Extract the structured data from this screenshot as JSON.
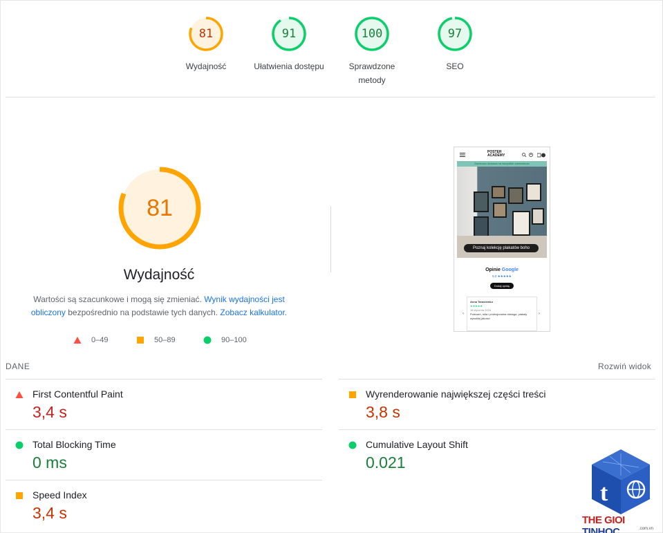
{
  "top_scores": [
    {
      "score": "81",
      "label": "Wydajność",
      "fraction": 0.81,
      "color": "#ffa400"
    },
    {
      "score": "91",
      "label": "Ułatwienia dostępu",
      "fraction": 0.91,
      "color": "#0cce6b"
    },
    {
      "score": "100",
      "label": "Sprawdzone",
      "label2": "metody",
      "fraction": 1.0,
      "color": "#0cce6b"
    },
    {
      "score": "97",
      "label": "SEO",
      "fraction": 0.97,
      "color": "#0cce6b"
    }
  ],
  "main": {
    "score": "81",
    "fraction": 0.81,
    "title": "Wydajność",
    "desc_part1": "Wartości są szacunkowe i mogą się zmieniać. ",
    "desc_link1": "Wynik wydajności jest obliczony",
    "desc_part2": " bezpośrednio na podstawie tych danych. ",
    "desc_link2": "Zobacz kalkulator",
    "desc_part3": "."
  },
  "legend": [
    {
      "range": "0–49",
      "color": "#ff4e42",
      "shape": "triangle"
    },
    {
      "range": "50–89",
      "color": "#ffa400",
      "shape": "square"
    },
    {
      "range": "90–100",
      "color": "#0cce6b",
      "shape": "circle"
    }
  ],
  "phone": {
    "logo_line1": "POSTER",
    "logo_line2": "ACADEMY",
    "banner": "Darmowa dostawa na wszystkie zamówienia",
    "cta": "Poznaj kolekcję plakatów boho",
    "opinions": "Opinie",
    "google": "Google",
    "rating": "5.0 ★★★★★",
    "pill": "Dodaj opinię",
    "reviewer": "Anna Tarasiewicz",
    "review_date": "18 stycznia 2024",
    "review_text": "Polecam, miła i profesjonalna obsługa, plakaty wysokiej jakości"
  },
  "metrics_header": {
    "title": "DANE",
    "expand": "Rozwiń widok"
  },
  "metrics": [
    {
      "name": "First Contentful Paint",
      "value": "3,4 s",
      "status": "red",
      "shape": "triangle"
    },
    {
      "name": "Wyrenderowanie największej części treści",
      "value": "3,8 s",
      "status": "orange",
      "shape": "square"
    },
    {
      "name": "Total Blocking Time",
      "value": "0 ms",
      "status": "green",
      "shape": "circle"
    },
    {
      "name": "Cumulative Layout Shift",
      "value": "0.021",
      "status": "green",
      "shape": "circle"
    },
    {
      "name": "Speed Index",
      "value": "3,4 s",
      "status": "orange",
      "shape": "square"
    }
  ],
  "watermark": {
    "text_red": "THE GIOI ",
    "text_blue": "TINHOC",
    "sub": ".com.vn"
  }
}
